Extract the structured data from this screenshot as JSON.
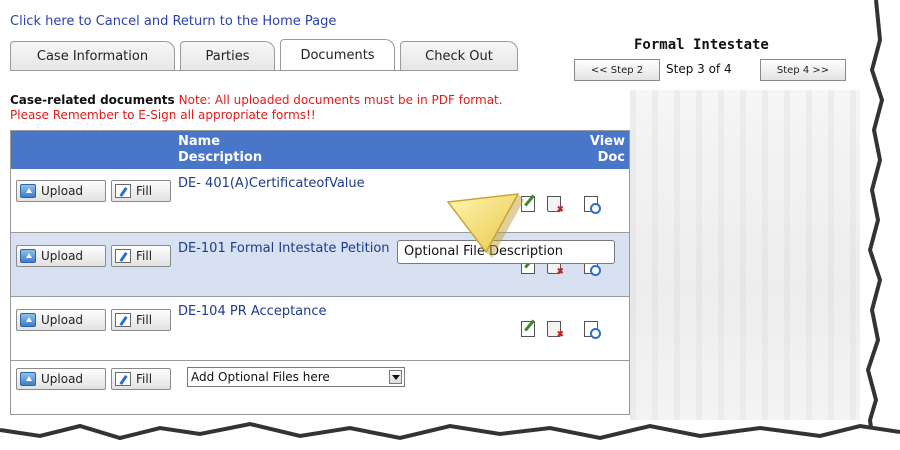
{
  "cancel_link": "Click here to Cancel and Return to the Home Page",
  "tabs": [
    {
      "label": "Case Information",
      "active": false
    },
    {
      "label": "Parties",
      "active": false
    },
    {
      "label": "Documents",
      "active": true
    },
    {
      "label": "Check Out",
      "active": false
    }
  ],
  "case_type": "Formal Intestate",
  "steps": {
    "prev_label": "<< Step 2",
    "current_text": "Step 3 of 4",
    "next_label": "Step 4 >>"
  },
  "notes": {
    "title": "Case-related documents",
    "pdf_note": "Note: All uploaded documents must be in PDF format.",
    "esign_note": "Please Remember to E-Sign all appropriate forms!!"
  },
  "table": {
    "header_name": "Name",
    "header_description": "Description",
    "header_view": "View",
    "header_doc": "Doc",
    "rows": [
      {
        "name": "DE- 401(A)CertificateofValue"
      },
      {
        "name": "DE-101 Formal Intestate Petition"
      },
      {
        "name": "DE-104 PR Acceptance"
      }
    ],
    "optional": {
      "select_value": "Add Optional Files here",
      "description_value": "Optional File Description"
    }
  },
  "buttons": {
    "upload": "Upload",
    "fill": "Fill"
  },
  "icons": [
    "upload-folder-icon",
    "fill-form-icon",
    "edit-icon",
    "delete-icon",
    "view-doc-icon",
    "pointer-arrow-icon"
  ],
  "colors": {
    "header_blue": "#4a76c9",
    "alt_row": "#d8e1f1",
    "note_red": "#e01b1b",
    "link_blue": "#2a3fb0"
  }
}
